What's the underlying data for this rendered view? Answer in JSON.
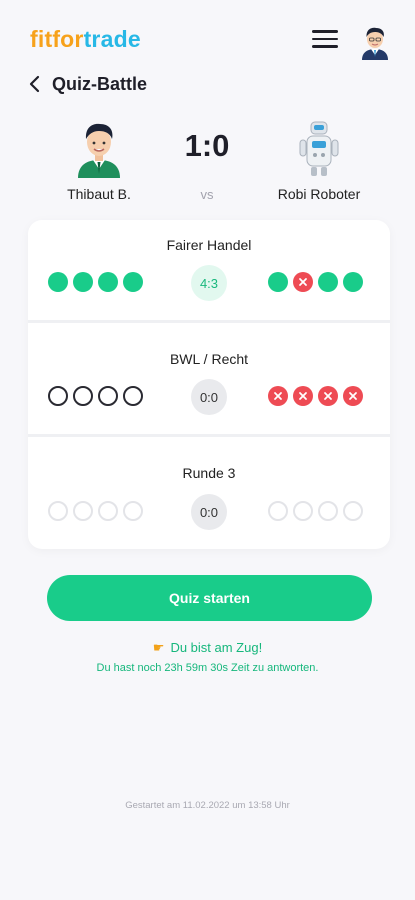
{
  "header": {
    "logo_part1": "fit",
    "logo_part2": "for",
    "logo_part3": "trade",
    "menu_icon": "hamburger-menu-icon",
    "avatar_icon": "user-avatar-icon"
  },
  "nav": {
    "back_icon": "chevron-left-icon",
    "title": "Quiz-Battle"
  },
  "match": {
    "player1": {
      "name": "Thibaut B.",
      "avatar_icon": "man-avatar-icon"
    },
    "player2": {
      "name": "Robi Roboter",
      "avatar_icon": "robot-avatar-icon"
    },
    "score": "1:0",
    "vs": "vs"
  },
  "rounds": [
    {
      "title": "Fairer Handel",
      "left": [
        "correct",
        "correct",
        "correct",
        "correct"
      ],
      "right": [
        "correct",
        "wrong",
        "correct",
        "correct"
      ],
      "result": "4:3",
      "result_style": "win"
    },
    {
      "title": "BWL / Recht",
      "left": [
        "unanswered",
        "unanswered",
        "unanswered",
        "unanswered"
      ],
      "right": [
        "wrong",
        "wrong",
        "wrong",
        "wrong"
      ],
      "result": "0:0",
      "result_style": "neutral"
    },
    {
      "title": "Runde 3",
      "left": [
        "pending",
        "pending",
        "pending",
        "pending"
      ],
      "right": [
        "pending",
        "pending",
        "pending",
        "pending"
      ],
      "result": "0:0",
      "result_style": "neutral"
    }
  ],
  "action": {
    "start_label": "Quiz starten",
    "turn_icon": "pointing-hand-icon",
    "turn_text": "Du bist am Zug!",
    "timer_text": "Du hast noch 23h 59m 30s Zeit zu antworten."
  },
  "footer": {
    "started_text": "Gestartet am 11.02.2022 um 13:58 Uhr"
  },
  "colors": {
    "green": "#19cc8a",
    "red": "#ee4b54",
    "logo_orange": "#f7a21b",
    "logo_blue": "#27b8e6"
  }
}
